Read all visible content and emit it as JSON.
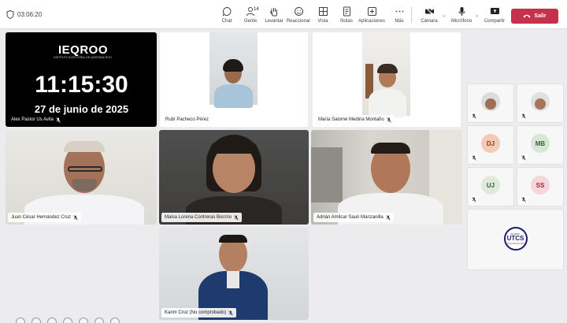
{
  "meeting": {
    "elapsed": "03:06:20"
  },
  "toolbar": {
    "chat": "Chat",
    "people": "Gente",
    "people_count": "14",
    "raise": "Levantar",
    "react": "Reaccionar",
    "view": "Vista",
    "notes": "Notas",
    "apps": "Aplicaciones",
    "more": "Más",
    "camera": "Cámara",
    "mic": "Micrófono",
    "share": "Compartir",
    "leave": "Salir"
  },
  "clock_tile": {
    "logo": "IEQROO",
    "subtitle": "INSTITUTO ELECTORAL DE QUINTANA ROO",
    "time": "11:15:30",
    "date": "27 de junio de 2025",
    "name": "Alex Pastor Us Avila"
  },
  "participants": [
    {
      "name": "Rubí Pacheco Pérez"
    },
    {
      "name": "María Salomé Medina Montaño"
    },
    {
      "name": "Juan César Hernández Cruz"
    },
    {
      "name": "Maisa Lorena Contreras Bocrrio"
    },
    {
      "name": "Adrián Amilcar Sauri Manzanilla"
    },
    {
      "name": "Karim Cruz (No comprobado)"
    }
  ],
  "side_tiles": [
    {
      "initials": "",
      "kind": "photo"
    },
    {
      "initials": "",
      "kind": "photo"
    },
    {
      "initials": "DJ",
      "color": "#f3c9b7",
      "text_color": "#8a3b1b"
    },
    {
      "initials": "MB",
      "color": "#d8e6d6",
      "text_color": "#3d5a3a"
    },
    {
      "initials": "UJ",
      "color": "#dfeadc",
      "text_color": "#2f5d3a"
    },
    {
      "initials": "SS",
      "color": "#f6d6dc",
      "text_color": "#a4262c"
    }
  ],
  "utcs_logo": {
    "top": "IEQROO",
    "mid": "UTCS",
    "bot": "COMUNICACIÓN"
  },
  "colors": {
    "leave": "#c4314b",
    "background": "#ececef"
  }
}
